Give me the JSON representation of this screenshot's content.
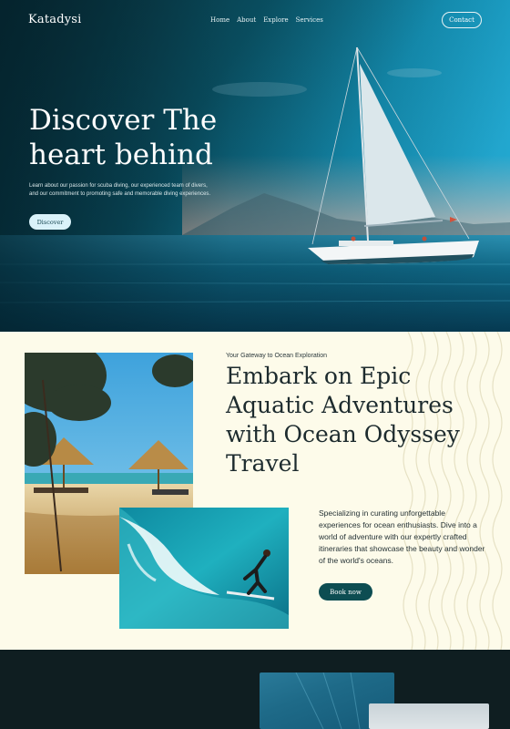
{
  "nav": {
    "logo": "Katadysi",
    "links": [
      "Home",
      "About",
      "Explore",
      "Services"
    ],
    "contact_label": "Contact"
  },
  "hero": {
    "title": "Discover The heart behind",
    "text": "Learn about our passion for scuba diving, our experienced team of divers, and our commitment to promoting safe and memorable diving experiences.",
    "button_label": "Discover"
  },
  "about": {
    "eyebrow": "Your Gateway to Ocean Exploration",
    "title": "Embark on Epic Aquatic Adventures with Ocean Odyssey Travel",
    "text": "Specializing in curating unforgettable experiences for ocean enthusiasts. Dive into a world of adventure with our expertly crafted itineraries that showcase the beauty and wonder of the world's oceans.",
    "button_label": "Book now"
  },
  "colors": {
    "accent_dark_teal": "#0d4d52",
    "cream_background": "#fdfbea",
    "dark_section": "#0f1e21",
    "discover_button": "#d9f2fa"
  },
  "icons": {
    "hero_image": "sailboat-photo",
    "beach_image": "beach-umbrellas-photo",
    "surf_image": "surfer-wave-photo"
  }
}
